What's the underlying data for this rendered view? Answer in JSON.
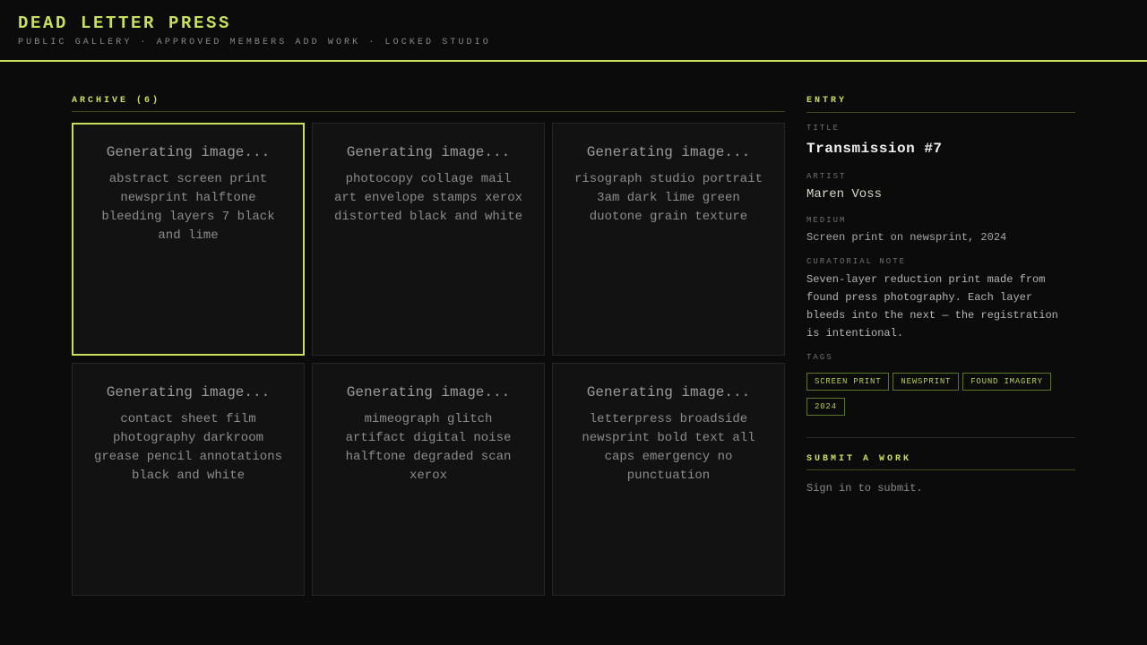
{
  "header": {
    "brand": "DEAD LETTER PRESS",
    "tagline": "PUBLIC GALLERY · APPROVED MEMBERS ADD WORK · LOCKED STUDIO"
  },
  "archive": {
    "label": "ARCHIVE (6)",
    "items": [
      {
        "status": "Generating image...",
        "prompt": "abstract screen print newsprint halftone bleeding layers 7 black and lime",
        "selected": true
      },
      {
        "status": "Generating image...",
        "prompt": "photocopy collage mail art envelope stamps xerox distorted black and white",
        "selected": false
      },
      {
        "status": "Generating image...",
        "prompt": "risograph studio portrait 3am dark lime green duotone grain texture",
        "selected": false
      },
      {
        "status": "Generating image...",
        "prompt": "contact sheet film photography darkroom grease pencil annotations black and white",
        "selected": false
      },
      {
        "status": "Generating image...",
        "prompt": "mimeograph glitch artifact digital noise halftone degraded scan xerox",
        "selected": false
      },
      {
        "status": "Generating image...",
        "prompt": "letterpress broadside newsprint bold text all caps emergency no punctuation",
        "selected": false
      }
    ]
  },
  "entry": {
    "label": "ENTRY",
    "title_label": "TITLE",
    "title": "Transmission #7",
    "artist_label": "ARTIST",
    "artist": "Maren Voss",
    "medium_label": "MEDIUM",
    "medium": "Screen print on newsprint, 2024",
    "note_label": "CURATORIAL NOTE",
    "note": "Seven-layer reduction print made from found press photography. Each layer bleeds into the next — the registration is intentional.",
    "tags_label": "TAGS",
    "tags": [
      "SCREEN PRINT",
      "NEWSPRINT",
      "FOUND IMAGERY",
      "2024"
    ]
  },
  "submit": {
    "label": "SUBMIT A WORK",
    "message": "Sign in to submit."
  },
  "colors": {
    "accent": "#c6e05a",
    "background": "#0b0b0b",
    "card": "#121212"
  }
}
